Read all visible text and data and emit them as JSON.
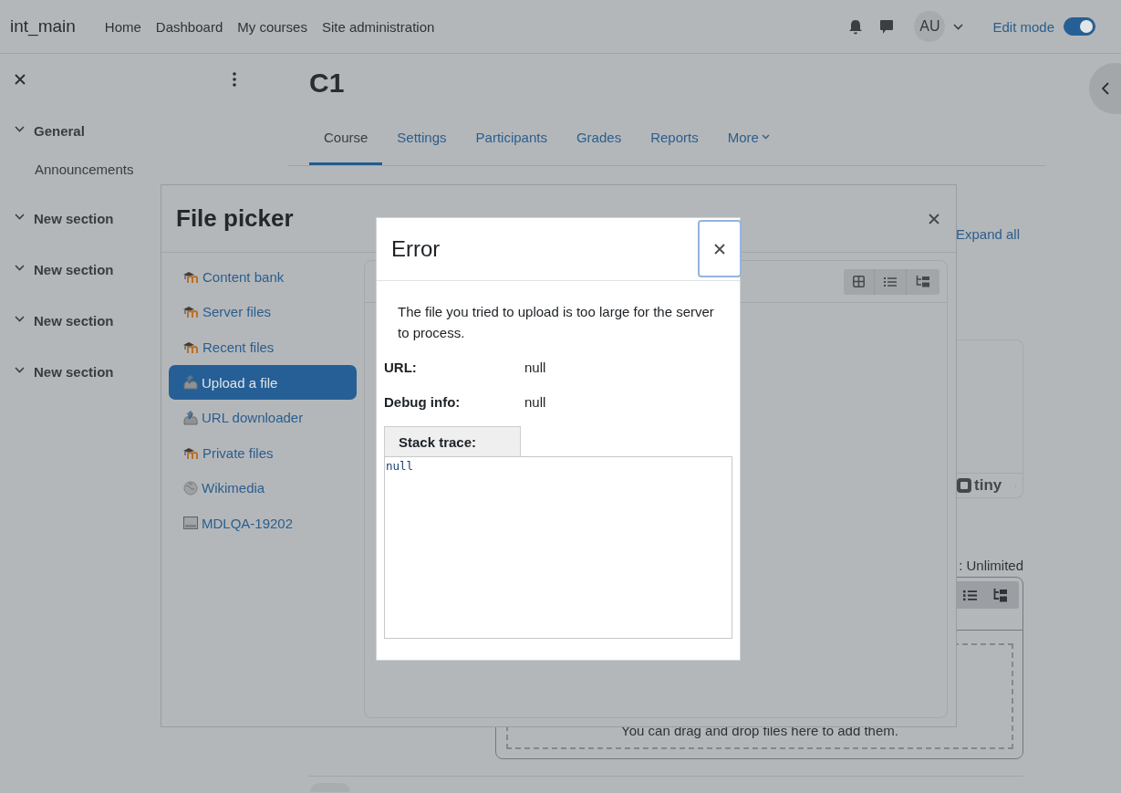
{
  "navbar": {
    "site_name": "int_main",
    "links": [
      {
        "label": "Home"
      },
      {
        "label": "Dashboard"
      },
      {
        "label": "My courses"
      },
      {
        "label": "Site administration"
      }
    ],
    "avatar_initials": "AU",
    "edit_mode": {
      "label": "Edit mode",
      "on": true
    }
  },
  "course_index": {
    "sections": [
      {
        "title": "General",
        "expanded": true,
        "children": [
          {
            "title": "Announcements"
          }
        ]
      },
      {
        "title": "New section",
        "expanded": true
      },
      {
        "title": "New section",
        "expanded": true
      },
      {
        "title": "New section",
        "expanded": true
      },
      {
        "title": "New section",
        "expanded": true
      }
    ]
  },
  "course": {
    "title": "C1",
    "tabs": [
      {
        "label": "Course",
        "selected": true,
        "kind": "link"
      },
      {
        "label": "Settings",
        "selected": false,
        "kind": "link"
      },
      {
        "label": "Participants",
        "selected": false,
        "kind": "link"
      },
      {
        "label": "Grades",
        "selected": false,
        "kind": "link"
      },
      {
        "label": "Reports",
        "selected": false,
        "kind": "link"
      },
      {
        "label": "More",
        "selected": false,
        "kind": "menu"
      }
    ],
    "expand_all": "Expand all",
    "editor": {
      "logo": "tiny"
    },
    "files": {
      "limit_text": ": Unlimited",
      "drop_hint": "You can drag and drop files here to add them."
    }
  },
  "file_picker": {
    "title": "File picker",
    "repositories": [
      {
        "label": "Content bank",
        "kind": "moodle",
        "selected": false
      },
      {
        "label": "Server files",
        "kind": "moodle",
        "selected": false
      },
      {
        "label": "Recent files",
        "kind": "moodle",
        "selected": false
      },
      {
        "label": "Upload a file",
        "kind": "upload",
        "selected": true
      },
      {
        "label": "URL downloader",
        "kind": "upload",
        "selected": false
      },
      {
        "label": "Private files",
        "kind": "moodle",
        "selected": false
      },
      {
        "label": "Wikimedia",
        "kind": "globe",
        "selected": false
      },
      {
        "label": "MDLQA-19202",
        "kind": "drive",
        "selected": false
      }
    ]
  },
  "error_dialog": {
    "title": "Error",
    "message": "The file you tried to upload is too large for the server to process.",
    "fields": [
      {
        "label": "URL:",
        "value": "null"
      },
      {
        "label": "Debug info:",
        "value": "null"
      }
    ],
    "stack_trace": {
      "label": "Stack trace:",
      "content": "null"
    }
  }
}
